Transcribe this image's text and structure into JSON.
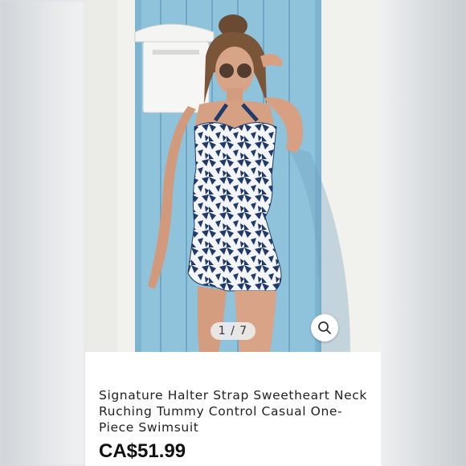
{
  "product": {
    "title": "Signature Halter Strap Sweetheart Neck Ruching Tummy Control Casual One-Piece Swimsuit",
    "price": "CA$51.99"
  },
  "gallery": {
    "pager_text": "1 / 7",
    "zoom_icon": "search-icon"
  },
  "colors": {
    "door_blue": "#8fc3dc",
    "swimsuit_navy": "#1f3a6b",
    "wall_white": "#f2f2f0"
  }
}
